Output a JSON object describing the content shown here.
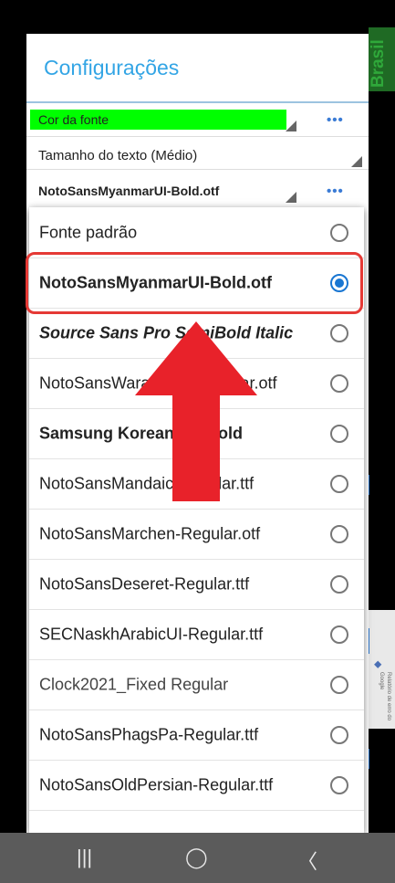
{
  "background": {
    "side_label": "Brasil",
    "map_attribution": "Relatório de erro do Google"
  },
  "settings": {
    "title": "Configurações",
    "font_color_label": "Cor da fonte",
    "font_color_swatch": "#00ff00",
    "text_size_label": "Tamanho do texto (Médio)",
    "font_label": "NotoSansMyanmarUI-Bold.otf",
    "more_glyph": "•••"
  },
  "font_dropdown": {
    "options": [
      {
        "label": "Fonte padrão",
        "selected": false
      },
      {
        "label": "NotoSansMyanmarUI-Bold.otf",
        "selected": true
      },
      {
        "label": "Source Sans Pro SemiBold Italic",
        "selected": false
      },
      {
        "label": "NotoSansWarangCiti-Regular.otf",
        "selected": false
      },
      {
        "label": "Samsung Korean 1.0 Bold",
        "selected": false
      },
      {
        "label": "NotoSansMandaic-Regular.ttf",
        "selected": false
      },
      {
        "label": "NotoSansMarchen-Regular.otf",
        "selected": false
      },
      {
        "label": "NotoSansDeseret-Regular.ttf",
        "selected": false
      },
      {
        "label": "SECNaskhArabicUI-Regular.ttf",
        "selected": false
      },
      {
        "label": "Clock2021_Fixed Regular",
        "selected": false
      },
      {
        "label": "NotoSansPhagsPa-Regular.ttf",
        "selected": false
      },
      {
        "label": "NotoSansOldPersian-Regular.ttf",
        "selected": false
      }
    ]
  },
  "annotation": {
    "box_color": "#e53935",
    "arrow_color": "#e8222a"
  },
  "navbar": {
    "recents_glyph": "|||",
    "home_glyph": "◯",
    "back_glyph": "〈"
  }
}
